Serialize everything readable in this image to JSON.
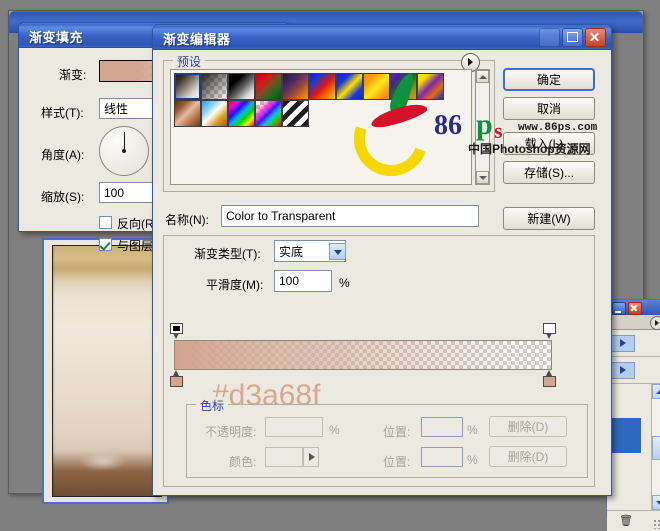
{
  "app": {
    "photoshop_window_title": "",
    "background": "#808080"
  },
  "document_window": {
    "name": "document-canvas"
  },
  "palette": {
    "title": "",
    "rows": 2,
    "trash_icon": "trash-icon",
    "menu_icon": "panel-menu-icon"
  },
  "gradient_fill_dialog": {
    "title": "渐变填充",
    "rows": {
      "gradient_label": "渐变:",
      "style_label": "样式(T):",
      "style_value": "线性",
      "angle_label": "角度(A):",
      "angle_value": "90",
      "scale_label": "缩放(S):",
      "scale_value": "100",
      "reverse_label": "反向(R)",
      "reverse_checked": false,
      "align_label": "与图层对齐",
      "align_checked": true
    },
    "gradient_preview_color": "#d3a68f"
  },
  "gradient_editor_dialog": {
    "title": "渐变编辑器",
    "titlebar_buttons": [
      "minimize-button",
      "maximize-button",
      "close-button"
    ],
    "presets": {
      "legend": "预设",
      "menu_icon": "preset-menu-icon",
      "selected_index": 0,
      "swatches": [
        {
          "name": "foreground-to-background",
          "css": "linear-gradient(135deg,#1d1713 0%,#3b322c 22%,#8d8178 48%,#d9d2ca 72%,#ffffff 100%)"
        },
        {
          "name": "foreground-to-transparent",
          "css": "checker"
        },
        {
          "name": "black-white",
          "css": "linear-gradient(135deg,#000000 0%,#000000 28%,#6a6a6a 56%,#d9d9d9 80%,#ffffff 100%)"
        },
        {
          "name": "red-green",
          "css": "linear-gradient(135deg,#c30000 0%,#d81616 28%,#7b4e22 52%,#1c6b1f 76%,#0a4a10 100%)"
        },
        {
          "name": "violet-orange",
          "css": "linear-gradient(135deg,#241a3a 0%,#4a2668 32%,#9c4a35 62%,#e87b12 86%,#f39b0b 100%)"
        },
        {
          "name": "blue-red-yellow",
          "css": "linear-gradient(135deg,#0a23c8 0%,#1b3ad4 22%,#e01515 52%,#f26a09 74%,#ffd400 100%)"
        },
        {
          "name": "blue-yellow-blue",
          "css": "linear-gradient(135deg,#0b2ccb 0%,#1738d6 26%,#ffe000 52%,#1738d6 78%,#0b2ccb 100%)"
        },
        {
          "name": "orange-yellow-orange",
          "css": "linear-gradient(135deg,#f28a00 0%,#f7a412 26%,#ffe81d 52%,#f7a412 78%,#ef7f00 100%)"
        },
        {
          "name": "violet-green-orange",
          "css": "linear-gradient(135deg,#7c1ea5 0%,#4c1f93 22%,#17742b 52%,#7c9a17 74%,#f08a12 100%)"
        },
        {
          "name": "yellow-violet-orange-blue",
          "css": "linear-gradient(135deg,#ffe000 0%,#f6d800 22%,#7a2aa8 48%,#e06a12 72%,#0d2fbd 100%)"
        },
        {
          "name": "copper",
          "css": "linear-gradient(135deg,#5a2f16 0%,#9b5c34 24%,#e3bca2 48%,#b8764a 72%,#6b3a1c 100%)"
        },
        {
          "name": "chrome",
          "css": "linear-gradient(135deg,#29a3e8 0%,#8fd0f2 28%,#ffffff 48%,#d9a01e 72%,#8a6514 100%)"
        },
        {
          "name": "spectrum",
          "css": "linear-gradient(135deg,#ff0000 0%,#ff00d0 16%,#2b00ff 34%,#00b7ff 50%,#00d400 66%,#e8ff00 82%,#ff0000 100%)"
        },
        {
          "name": "transparent-rainbow",
          "css": "rainbow-checker"
        },
        {
          "name": "transparent-stripes",
          "css": "stripes"
        }
      ],
      "scrollbar": "presets-scrollbar"
    },
    "name_label": "名称(N):",
    "name_value": "Color to Transparent",
    "new_button": "新建(W)",
    "gradient_type_label": "渐变类型(T):",
    "gradient_type_value": "实底",
    "smoothness_label": "平滑度(M):",
    "smoothness_value": "100",
    "smoothness_unit": "%",
    "stops": {
      "legend": "色标",
      "opacity_label": "不透明度:",
      "opacity_value": "",
      "opacity_unit": "%",
      "location_label_1": "位置:",
      "location_value_1": "",
      "location_unit_1": "%",
      "delete_button_1": "删除(D)",
      "color_label": "颜色:",
      "color_value": "",
      "location_label_2": "位置:",
      "location_value_2": "",
      "location_unit_2": "%",
      "delete_button_2": "删除(D)"
    },
    "buttons": {
      "ok": "确定",
      "cancel": "取消",
      "load": "载入(L)...",
      "save": "存储(S)..."
    },
    "annotation_hex": "#d3a68f",
    "gradient_start_color": "#d3a68f",
    "gradient_end_color": "transparent"
  },
  "watermark": {
    "number": "86",
    "p": "p",
    "s": "s",
    "url": "www.86ps.com",
    "chinese": "中国Photoshop资源网"
  }
}
